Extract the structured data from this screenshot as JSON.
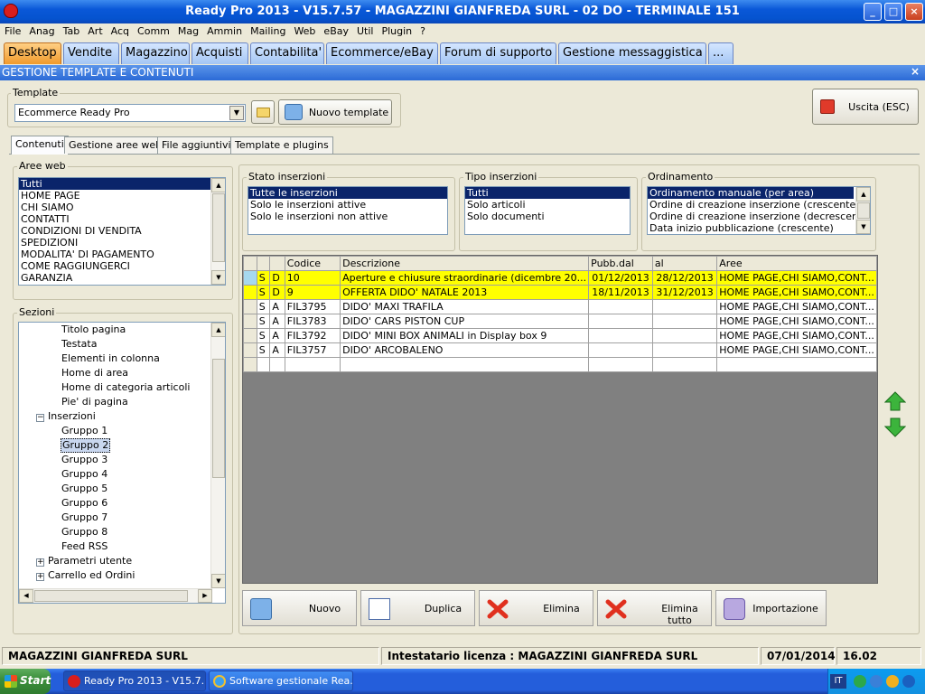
{
  "window": {
    "title": "Ready Pro 2013 - V15.7.57 - MAGAZZINI GIANFREDA SURL - 02 DO - TERMINALE 151",
    "buttons": {
      "minimize": "_",
      "maximize": "□",
      "close": "×"
    }
  },
  "menu": [
    "File",
    "Anag",
    "Tab",
    "Art",
    "Acq",
    "Comm",
    "Mag",
    "Ammin",
    "Mailing",
    "Web",
    "eBay",
    "Util",
    "Plugin",
    "?"
  ],
  "tabs": [
    "Desktop",
    "Vendite",
    "Magazzino",
    "Acquisti",
    "Contabilita'",
    "Ecommerce/eBay",
    "Forum di supporto",
    "Gestione messaggistica",
    "..."
  ],
  "section_title": "GESTIONE TEMPLATE E CONTENUTI",
  "section_close": "×",
  "template": {
    "group_label": "Template",
    "selected": "Ecommerce Ready Pro",
    "new_button": "Nuovo template"
  },
  "exit_button": "Uscita (ESC)",
  "subtabs": [
    "Contenuti",
    "Gestione aree web",
    "File aggiuntivi",
    "Template e plugins"
  ],
  "aree_web": {
    "label": "Aree web",
    "items": [
      "Tutti",
      "HOME PAGE",
      "CHI SIAMO",
      "CONTATTI",
      "CONDIZIONI DI VENDITA",
      "SPEDIZIONI",
      "MODALITA' DI PAGAMENTO",
      "COME RAGGIUNGERCI",
      "GARANZIA"
    ]
  },
  "sezioni": {
    "label": "Sezioni",
    "items": [
      {
        "text": "Titolo pagina",
        "level": 2
      },
      {
        "text": "Testata",
        "level": 2
      },
      {
        "text": "Elementi in colonna",
        "level": 2
      },
      {
        "text": "Home di area",
        "level": 2
      },
      {
        "text": "Home di categoria articoli",
        "level": 2
      },
      {
        "text": "Pie' di pagina",
        "level": 2
      },
      {
        "text": "Inserzioni",
        "level": 1,
        "toggle": "−"
      },
      {
        "text": "Gruppo 1",
        "level": 2
      },
      {
        "text": "Gruppo 2",
        "level": 2,
        "selected": true
      },
      {
        "text": "Gruppo 3",
        "level": 2
      },
      {
        "text": "Gruppo 4",
        "level": 2
      },
      {
        "text": "Gruppo 5",
        "level": 2
      },
      {
        "text": "Gruppo 6",
        "level": 2
      },
      {
        "text": "Gruppo 7",
        "level": 2
      },
      {
        "text": "Gruppo 8",
        "level": 2
      },
      {
        "text": "Feed RSS",
        "level": 2
      },
      {
        "text": "Parametri utente",
        "level": 1,
        "toggle": "+"
      },
      {
        "text": "Carrello ed Ordini",
        "level": 1,
        "toggle": "+"
      }
    ]
  },
  "stato_inserzioni": {
    "label": "Stato inserzioni",
    "items": [
      "Tutte le inserzioni",
      "Solo le inserzioni attive",
      "Solo le inserzioni non attive"
    ]
  },
  "tipo_inserzioni": {
    "label": "Tipo inserzioni",
    "items": [
      "Tutti",
      "Solo articoli",
      "Solo documenti"
    ]
  },
  "ordinamento": {
    "label": "Ordinamento",
    "items": [
      "Ordinamento manuale (per area)",
      "Ordine di creazione inserzione (crescente)",
      "Ordine di creazione inserzione (decrescente)",
      "Data inizio pubblicazione (crescente)"
    ]
  },
  "grid": {
    "headers": [
      "Codice",
      "Descrizione",
      "Pubb.dal",
      "al",
      "Aree"
    ],
    "rows": [
      {
        "s": "S",
        "t": "D",
        "codice": "10",
        "descrizione": "Aperture e chiusure straordinarie (dicembre 20...",
        "dal": "01/12/2013",
        "al": "28/12/2013",
        "aree": "HOME PAGE,CHI SIAMO,CONT...",
        "highlight": true
      },
      {
        "s": "S",
        "t": "D",
        "codice": "9",
        "descrizione": "OFFERTA DIDO' NATALE 2013",
        "dal": "18/11/2013",
        "al": "31/12/2013",
        "aree": "HOME PAGE,CHI SIAMO,CONT...",
        "highlight": true
      },
      {
        "s": "S",
        "t": "A",
        "codice": "FIL3795",
        "descrizione": "DIDO' MAXI TRAFILA",
        "dal": "",
        "al": "",
        "aree": "HOME PAGE,CHI SIAMO,CONT...",
        "highlight": false
      },
      {
        "s": "S",
        "t": "A",
        "codice": "FIL3783",
        "descrizione": "DIDO' CARS PISTON CUP",
        "dal": "",
        "al": "",
        "aree": "HOME PAGE,CHI SIAMO,CONT...",
        "highlight": false
      },
      {
        "s": "S",
        "t": "A",
        "codice": "FIL3792",
        "descrizione": "DIDO' MINI BOX ANIMALI  in Display box 9",
        "dal": "",
        "al": "",
        "aree": "HOME PAGE,CHI SIAMO,CONT...",
        "highlight": false
      },
      {
        "s": "S",
        "t": "A",
        "codice": "FIL3757",
        "descrizione": "DIDO' ARCOBALENO",
        "dal": "",
        "al": "",
        "aree": "HOME PAGE,CHI SIAMO,CONT...",
        "highlight": false
      }
    ]
  },
  "actions": [
    "Nuovo",
    "Duplica",
    "Elimina",
    "Elimina tutto",
    "Importazione"
  ],
  "status": {
    "company": "MAGAZZINI GIANFREDA SURL",
    "license": "Intestatario licenza : MAGAZZINI GIANFREDA SURL",
    "date": "07/01/2014",
    "time": "16.02"
  },
  "taskbar": {
    "start": "Start",
    "items": [
      "Ready Pro 2013 - V15.7....",
      "Software gestionale Rea..."
    ],
    "lang": "IT"
  },
  "colors": {
    "highlight_row": "#ffff00",
    "selection": "#0a246a",
    "active_tab": "#f09a2c",
    "title_bar": "#0a58d8"
  }
}
